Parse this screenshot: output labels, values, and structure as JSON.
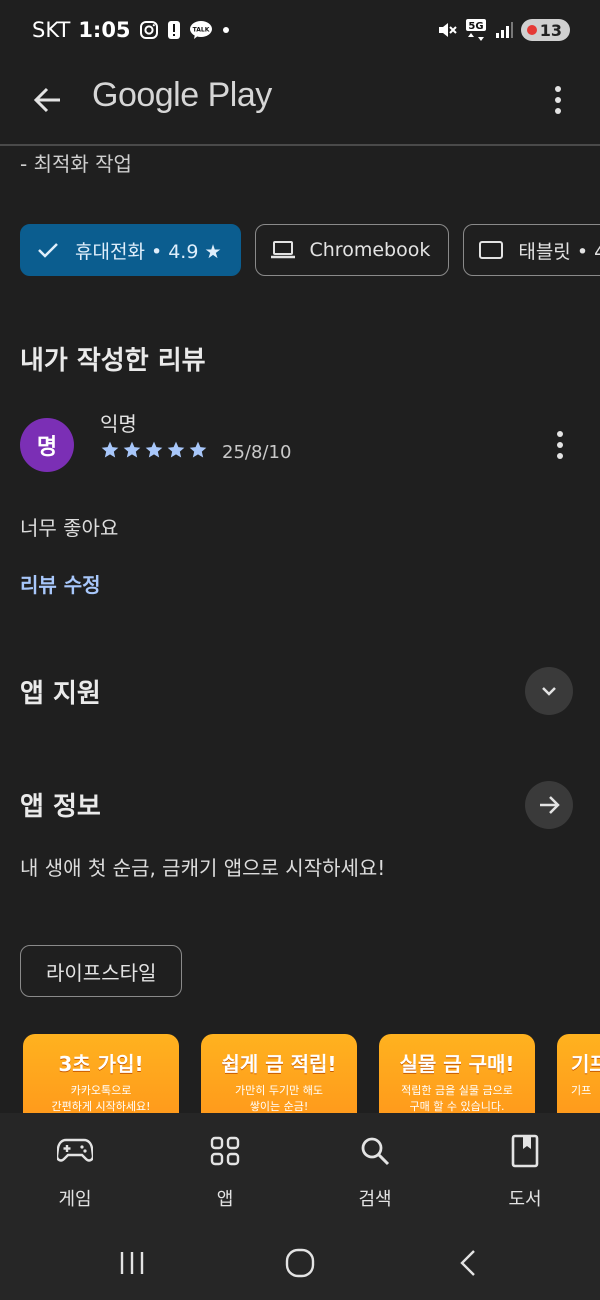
{
  "status_bar": {
    "carrier": "SKT",
    "time": "1:05",
    "icons": [
      "instagram-icon",
      "alert-icon",
      "kakaotalk-icon",
      "dot-icon",
      "mute-icon",
      "5g-icon",
      "signal-icon"
    ],
    "kakaotalk_label": "TALK",
    "network_label": "5G",
    "battery": "13"
  },
  "app_bar": {
    "title": "Google Play"
  },
  "whats_new": {
    "text": "- 최적화 작업"
  },
  "device_chips": [
    {
      "label": "휴대전화 • 4.9 ★",
      "icon": "check-icon",
      "selected": true
    },
    {
      "label": "Chromebook",
      "icon": "laptop-icon",
      "selected": false
    },
    {
      "label": "태블릿 • 4",
      "icon": "tablet-icon",
      "selected": false
    }
  ],
  "my_review": {
    "heading": "내가 작성한 리뷰",
    "avatar_initial": "명",
    "reviewer": "익명",
    "rating": 5,
    "date": "25/8/10",
    "text": "너무 좋아요",
    "edit_label": "리뷰 수정"
  },
  "app_support": {
    "heading": "앱 지원"
  },
  "app_info": {
    "heading": "앱 정보",
    "description": "내 생애 첫 순금, 금캐기 앱으로 시작하세요!",
    "category": "라이프스타일"
  },
  "screenshots": [
    {
      "title": "3초 가입!",
      "line1": "카카오톡으로",
      "line2": "간편하게 시작하세요!"
    },
    {
      "title": "쉽게 금 적립!",
      "line1": "가만히 두기만 해도",
      "line2": "쌓이는 순금!"
    },
    {
      "title": "실물 금 구매!",
      "line1": "적립한 금을 실물 금으로",
      "line2": "구매 할 수 있습니다."
    },
    {
      "title": "기프",
      "line1": "",
      "line2": "기프"
    }
  ],
  "bottom_nav": [
    {
      "label": "게임",
      "icon": "gamepad-icon"
    },
    {
      "label": "앱",
      "icon": "apps-grid-icon"
    },
    {
      "label": "검색",
      "icon": "search-icon"
    },
    {
      "label": "도서",
      "icon": "book-icon"
    }
  ],
  "colors": {
    "background": "#1f1f1f",
    "selected_chip": "#0b5d8f",
    "accent_link": "#a8c7fa",
    "star": "#a8c7fa",
    "avatar": "#7b2fb5"
  }
}
